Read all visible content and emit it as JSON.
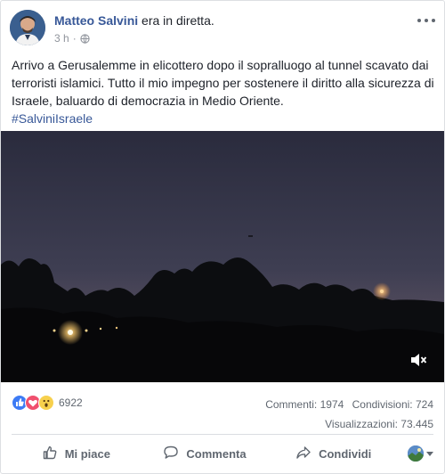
{
  "post": {
    "author": "Matteo Salvini",
    "action": "era in diretta.",
    "time": "3 h",
    "privacy_icon": "globe-icon",
    "text": "Arrivo a Gerusalemme in elicottero dopo il sopralluogo al tunnel scavato dai terroristi islamici. Tutto il mio impegno per sostenere il diritto alla sicurezza di Israele, baluardo di democrazia in Medio Oriente.",
    "hashtag": "#SalviniIsraele"
  },
  "video": {
    "mute_icon": "speaker-muted-icon"
  },
  "stats": {
    "reaction_icons": [
      "like-icon",
      "love-icon",
      "wow-icon"
    ],
    "reactions_count": "6922",
    "comments": "Commenti: 1974",
    "shares": "Condivisioni: 724",
    "views": "Visualizzazioni: 73.445"
  },
  "actions": {
    "like_label": "Mi piace",
    "comment_label": "Commenta",
    "share_label": "Condividi"
  },
  "colors": {
    "brand": "#385898",
    "like": "#3d7bf5",
    "love": "#f0506e",
    "wow": "#f7d04d"
  }
}
